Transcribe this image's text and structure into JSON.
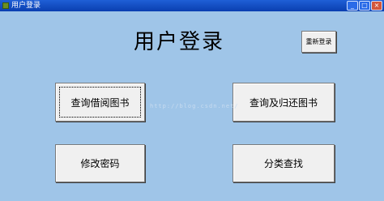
{
  "window": {
    "title": "用户登录",
    "buttons": {
      "minimize": "_",
      "maximize": "□",
      "close": "×"
    }
  },
  "main": {
    "heading": "用户登录",
    "watermark": "http://blog.csdn.net/"
  },
  "buttons": {
    "relogin": "重新登录",
    "query_borrow": "查询借阅图书",
    "query_return": "查询及归还图书",
    "change_password": "修改密码",
    "category_search": "分类查找"
  },
  "colors": {
    "background": "#9fc5e8",
    "titlebar": "#0a3fb0",
    "button_face": "#f0f0f0"
  }
}
